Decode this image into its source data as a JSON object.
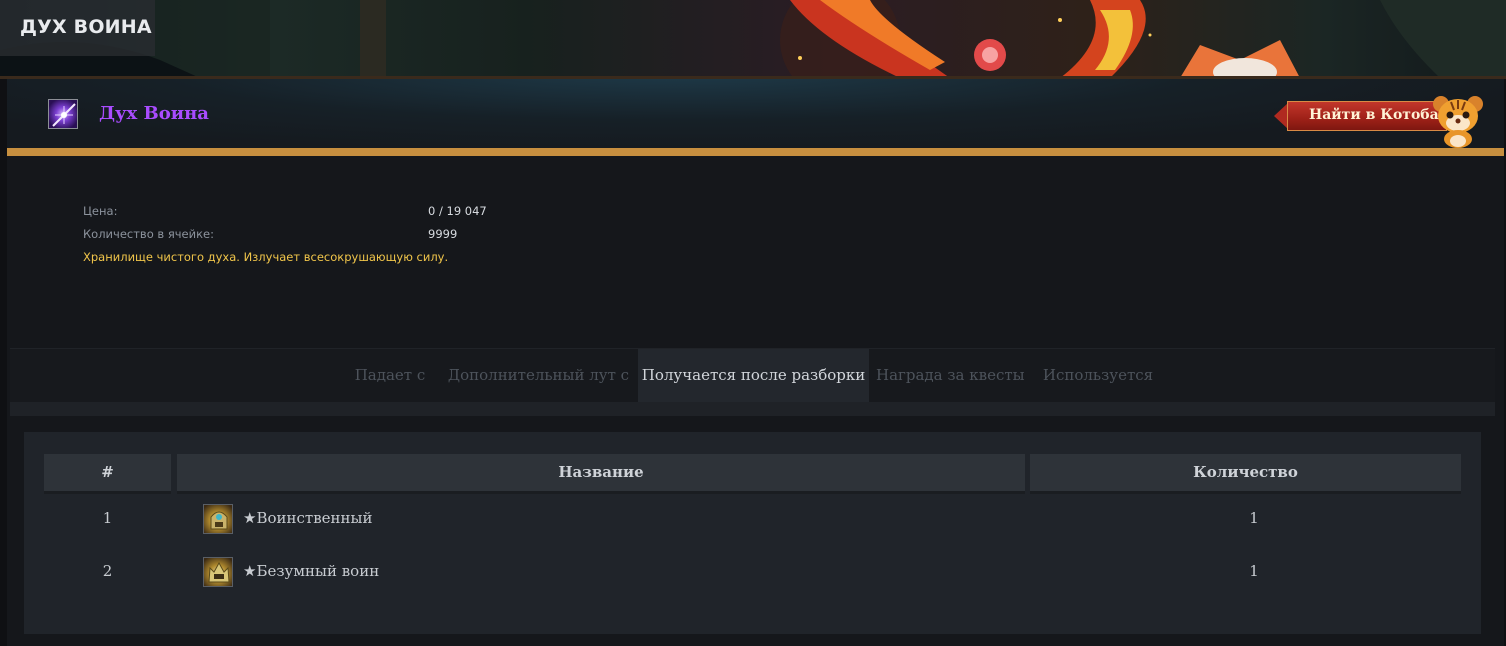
{
  "site": {
    "title": "ДУХ ВОИНА"
  },
  "item": {
    "name": "Дух Воина",
    "name_color": "#a94cff",
    "icon": "spirit-crystal-icon",
    "find_button_label": "Найти в Котобазе",
    "mascot": "tiger-mascot-icon"
  },
  "properties": [
    {
      "label": "Цена:",
      "value": "0 / 19 047"
    },
    {
      "label": "Количество в ячейке:",
      "value": "9999"
    }
  ],
  "description": "Хранилище чистого духа. Излучает всесокрушающую силу.",
  "tabs": [
    {
      "label": "Падает с",
      "active": false
    },
    {
      "label": "Дополнительный лут с",
      "active": false
    },
    {
      "label": "Получается после разборки",
      "active": true
    },
    {
      "label": "Награда за квесты",
      "active": false
    },
    {
      "label": "Используется",
      "active": false
    }
  ],
  "table": {
    "headers": [
      "#",
      "Название",
      "Количество"
    ],
    "rows": [
      {
        "index": "1",
        "name": "★Воинственный",
        "quantity": "1",
        "icon": "warrior-helmet-icon"
      },
      {
        "index": "2",
        "name": "★Безумный воин",
        "quantity": "1",
        "icon": "mad-warrior-helmet-icon"
      }
    ]
  },
  "colors": {
    "accent_gold": "#c78f3f",
    "description": "#f0c54a",
    "button_red": "#b02a20"
  }
}
